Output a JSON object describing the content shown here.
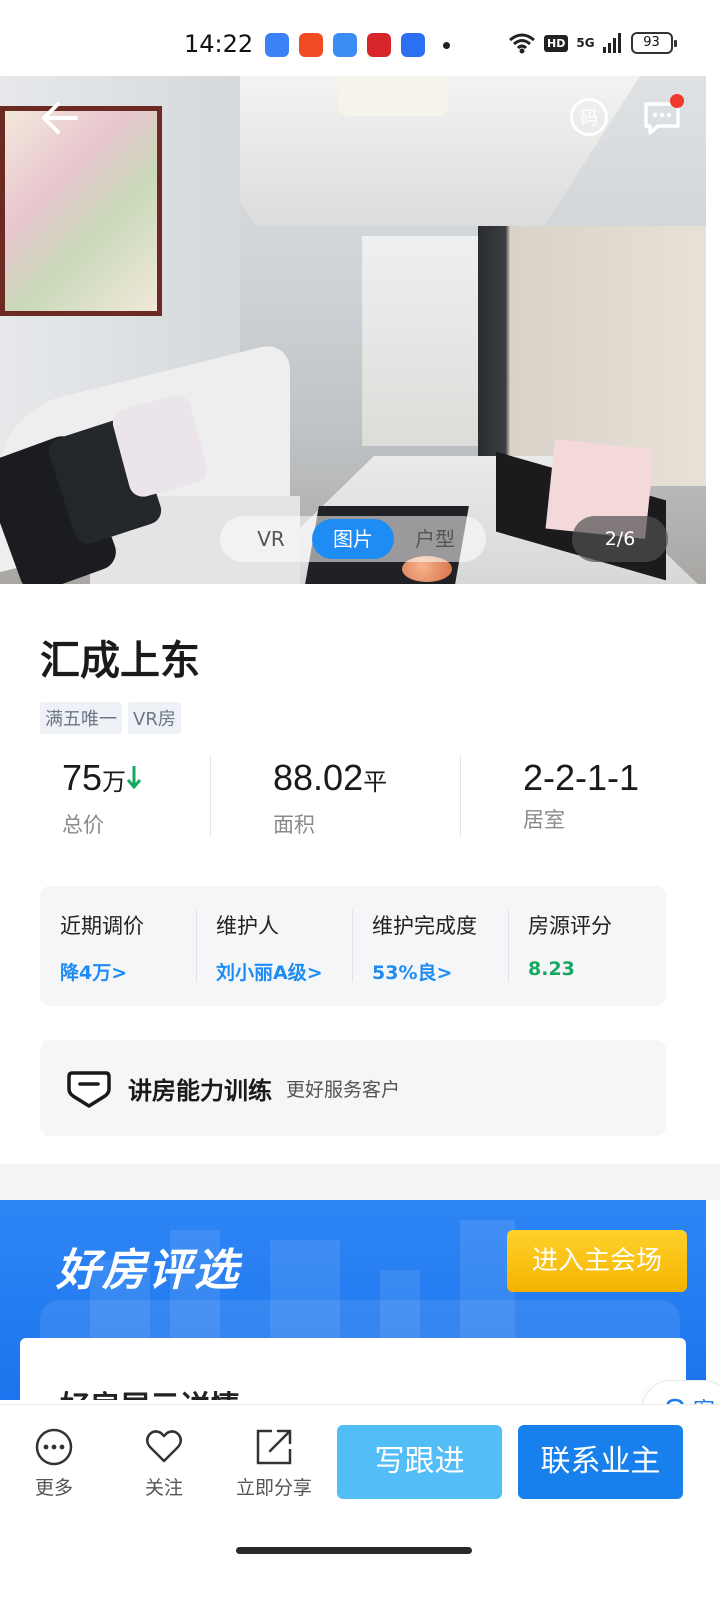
{
  "status_bar": {
    "time": "14:22",
    "network": "5G",
    "hd": "HD",
    "battery": "93",
    "app_icons": [
      "#3b82f6",
      "#f04b23",
      "#3b8cf5",
      "#d7262a",
      "#2b6ff2"
    ]
  },
  "header": {
    "qr_label": "码"
  },
  "media": {
    "tabs": [
      {
        "label": "VR",
        "active": false
      },
      {
        "label": "图片",
        "active": true
      },
      {
        "label": "户型",
        "active": false
      }
    ],
    "counter": "2/6"
  },
  "listing": {
    "title": "汇成上东",
    "tags": [
      "满五唯一",
      "VR房"
    ],
    "stats": {
      "price_value": "75",
      "price_unit": "万",
      "price_label": "总价",
      "area_value": "88.02",
      "area_unit": "平",
      "area_label": "面积",
      "layout_value": "2-2-1-1",
      "layout_label": "居室"
    }
  },
  "info_card": {
    "items": [
      {
        "label": "近期调价",
        "value": "降4万>",
        "color": "#1f8cf4"
      },
      {
        "label": "维护人",
        "value": "刘小丽A级>",
        "color": "#1f8cf4"
      },
      {
        "label": "维护完成度",
        "value": "53%良>",
        "color": "#1f8cf4"
      },
      {
        "label": "房源评分",
        "value": "8.23",
        "color": "#16a862"
      }
    ]
  },
  "training": {
    "title": "讲房能力训练",
    "subtitle": "更好服务客户"
  },
  "banner": {
    "title": "好房评选",
    "button": "进入主会场",
    "card_title": "好房展示详情"
  },
  "service": {
    "label": "客"
  },
  "bottom_bar": {
    "more": "更多",
    "follow": "关注",
    "share": "立即分享",
    "followup_btn": "写跟进",
    "contact_btn": "联系业主"
  },
  "colors": {
    "primary_blue": "#1880ec",
    "light_blue": "#52bdf6",
    "green": "#16a862",
    "banner_yellow": "#f4b400"
  }
}
